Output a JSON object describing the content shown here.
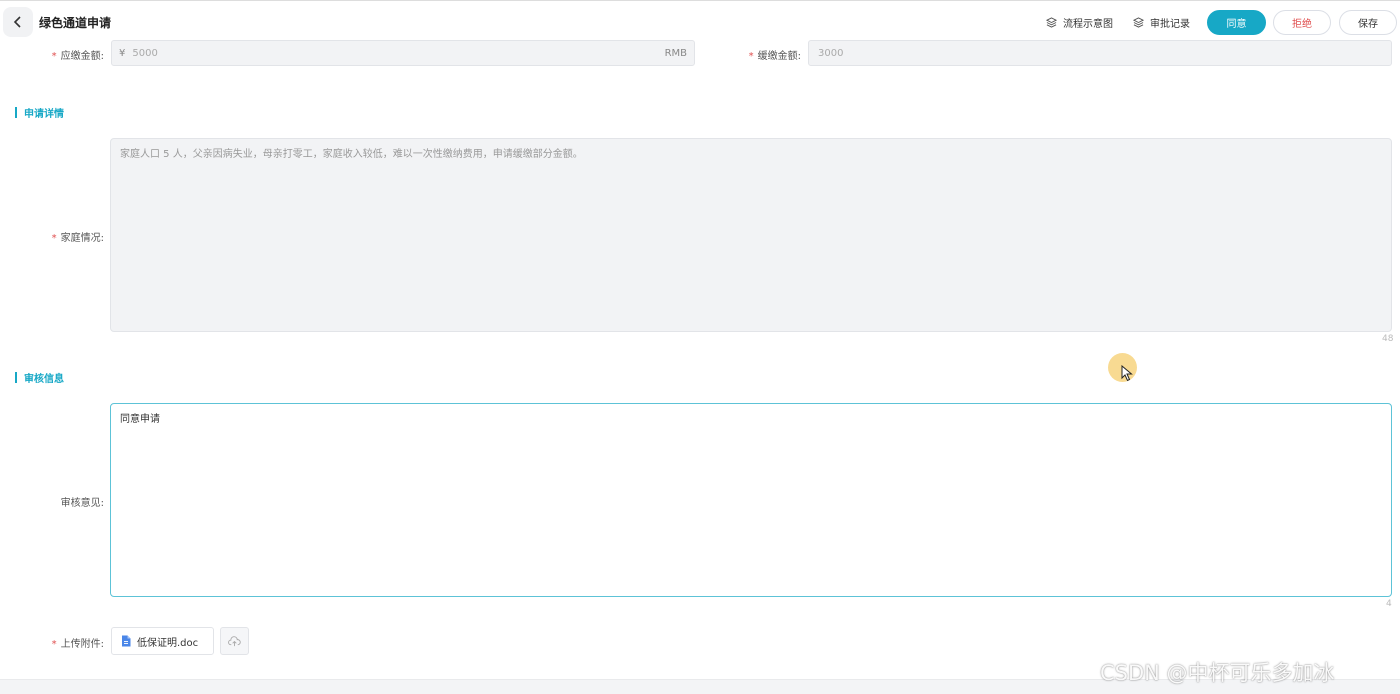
{
  "header": {
    "title": "绿色通道申请",
    "flow_label": "流程示意图",
    "records_label": "审批记录",
    "agree_label": "同意",
    "reject_label": "拒绝",
    "save_label": "保存"
  },
  "amounts": {
    "payable_label": "应缴金额:",
    "payable_prefix": "¥",
    "payable_value": "5000",
    "payable_suffix": "RMB",
    "deferred_label": "缓缴金额:",
    "deferred_value": "3000"
  },
  "details": {
    "section_title": "申请详情",
    "family_label": "家庭情况:",
    "family_text": "家庭人口 5 人，父亲因病失业，母亲打零工，家庭收入较低，难以一次性缴纳费用，申请缓缴部分金额。",
    "family_count": "48"
  },
  "review": {
    "section_title": "审核信息",
    "opinion_label": "审核意见:",
    "opinion_text": "同意申请",
    "opinion_count": "4",
    "attachment_label": "上传附件:",
    "file_name": "低保证明.doc"
  },
  "watermark": "CSDN @中杯可乐多加冰",
  "colors": {
    "accent": "#17a8c6",
    "danger": "#e04f4f"
  }
}
